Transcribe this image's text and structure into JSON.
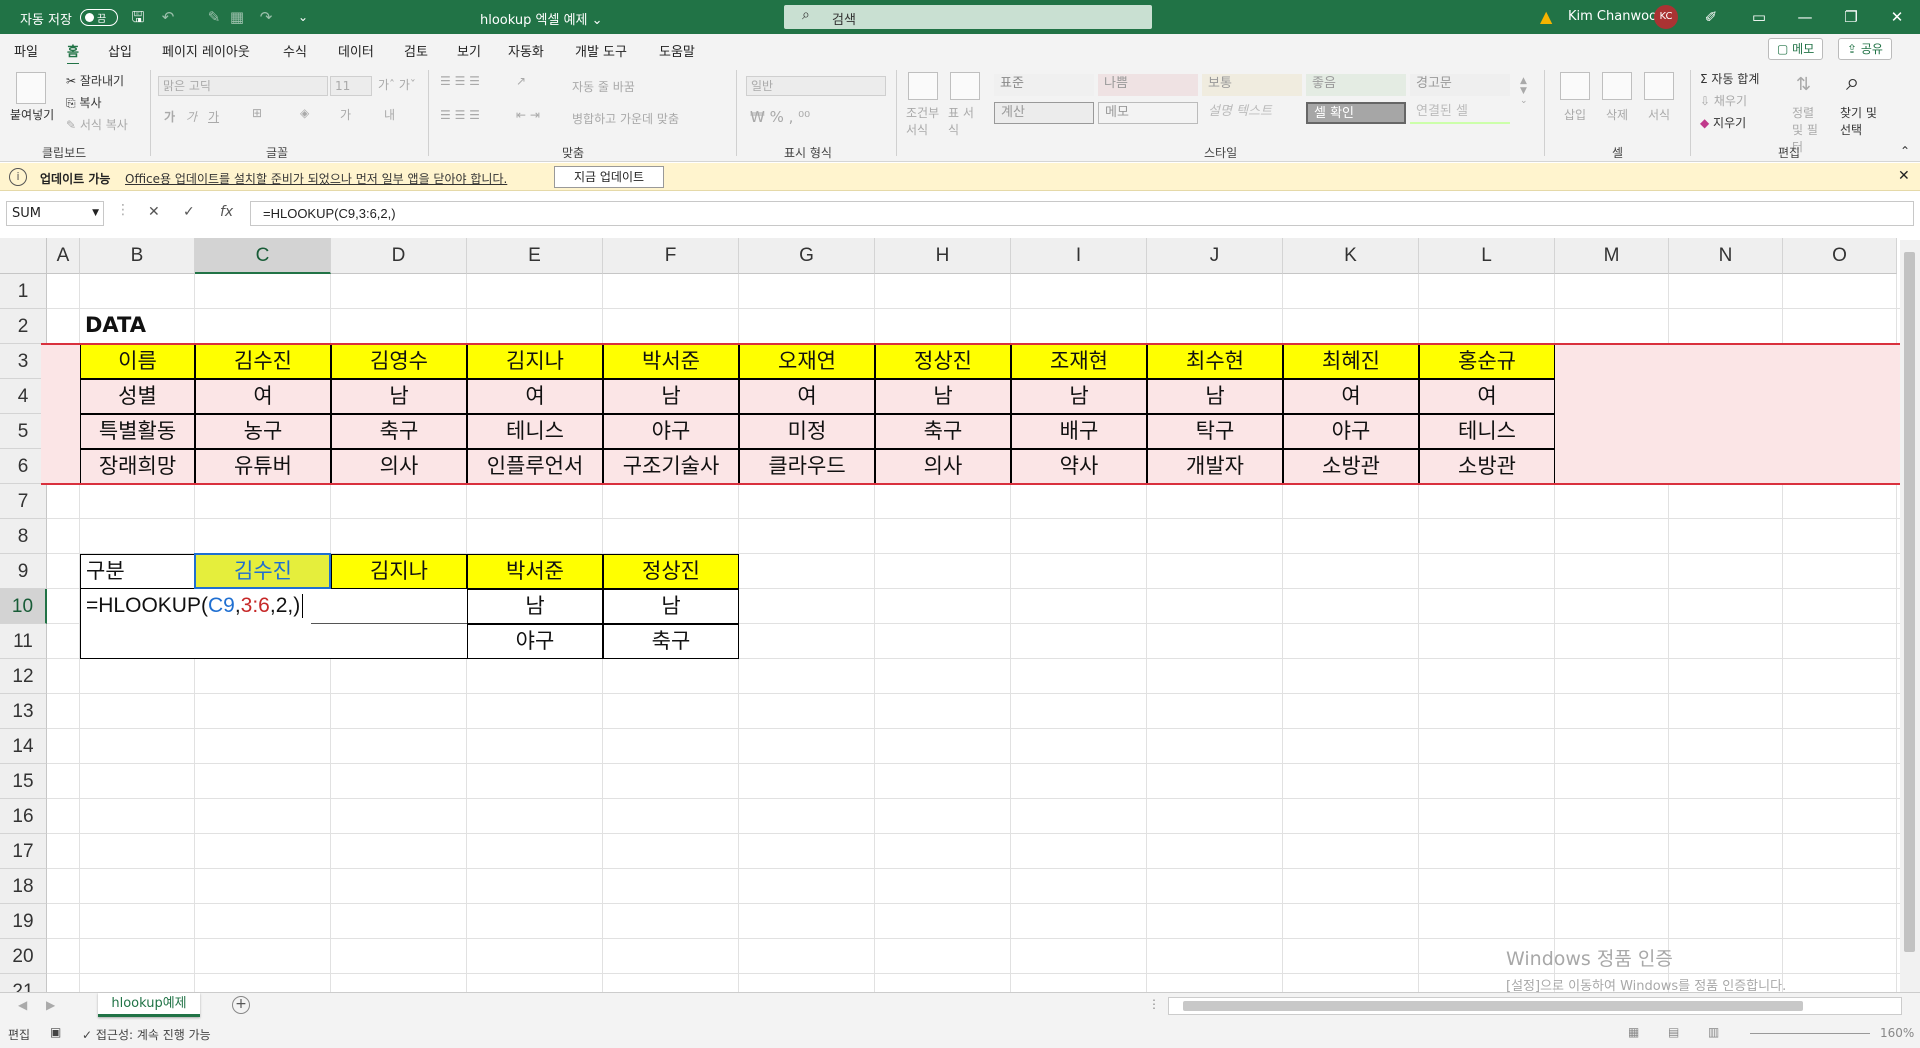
{
  "titlebar": {
    "autosave_label": "자동 저장",
    "autosave_state": "끔",
    "doc_title": "hlookup 엑셀 예제 ⌄",
    "search_placeholder": "검색",
    "user_name": "Kim Chanwoo",
    "user_initials": "KC"
  },
  "menu": {
    "tabs": [
      "파일",
      "홈",
      "삽입",
      "페이지 레이아웃",
      "수식",
      "데이터",
      "검토",
      "보기",
      "자동화",
      "개발 도구",
      "도움말"
    ],
    "active": "홈",
    "memo_label": "메모",
    "share_label": "공유"
  },
  "ribbon": {
    "clipboard": {
      "paste": "붙여넣기",
      "cut": "잘라내기",
      "copy": "복사",
      "format_painter": "서식 복사",
      "label": "클립보드"
    },
    "font": {
      "name": "맑은 고딕",
      "size": "11",
      "label": "글꼴"
    },
    "align": {
      "wrap": "자동 줄 바꿈",
      "merge": "병합하고 가운데 맞춤",
      "label": "맞춤"
    },
    "number": {
      "format": "일반",
      "label": "표시 형식"
    },
    "styles": {
      "cond_format": "조건부 서식",
      "table_format": "표 서식",
      "cells": [
        "표준",
        "나쁨",
        "보통",
        "좋음",
        "경고문",
        "계산",
        "메모",
        "설명 텍스트",
        "셀 확인",
        "연결된 셀"
      ],
      "label": "스타일"
    },
    "cells": {
      "insert": "삽입",
      "delete": "삭제",
      "format": "서식",
      "label": "셀"
    },
    "editing": {
      "autosum": "자동 합계",
      "fill": "채우기",
      "clear": "지우기",
      "sort": "정렬 및 필터",
      "find": "찾기 및 선택",
      "label": "편집"
    }
  },
  "infobar": {
    "title": "업데이트 가능",
    "message": "Office용 업데이트를 설치할 준비가 되었으나 먼저 일부 앱을 닫아야 합니다.",
    "button": "지금 업데이트"
  },
  "formulabar": {
    "namebox": "SUM",
    "formula": "=HLOOKUP(C9,3:6,2,)"
  },
  "grid": {
    "columns": [
      "A",
      "B",
      "C",
      "D",
      "E",
      "F",
      "G",
      "H",
      "I",
      "J",
      "K",
      "L",
      "M",
      "N",
      "O"
    ],
    "rows": [
      "1",
      "2",
      "3",
      "4",
      "5",
      "6",
      "7",
      "8",
      "9",
      "10",
      "11",
      "12",
      "13",
      "14",
      "15",
      "16",
      "17",
      "18",
      "19",
      "20",
      "21"
    ],
    "data_title": "DATA",
    "table": [
      [
        "이름",
        "김수진",
        "김영수",
        "김지나",
        "박서준",
        "오재연",
        "정상진",
        "조재현",
        "최수현",
        "최혜진",
        "홍순규"
      ],
      [
        "성별",
        "여",
        "남",
        "여",
        "남",
        "여",
        "남",
        "남",
        "남",
        "여",
        "여"
      ],
      [
        "특별활동",
        "농구",
        "축구",
        "테니스",
        "야구",
        "미정",
        "축구",
        "배구",
        "탁구",
        "야구",
        "테니스"
      ],
      [
        "장래희망",
        "유튜버",
        "의사",
        "인플루언서",
        "구조기술사",
        "클라우드",
        "의사",
        "약사",
        "개발자",
        "소방관",
        "소방관"
      ]
    ],
    "lookup_header": [
      "구분",
      "김수진",
      "김지나",
      "박서준",
      "정상진"
    ],
    "editing_formula": {
      "prefix": "=HLOOKUP(",
      "ref1": "C9",
      "comma1": ",",
      "ref2": "3:6",
      "suffix": ",2,)"
    },
    "row10_values": [
      "남",
      "남"
    ],
    "row11_values": [
      "야구",
      "축구"
    ],
    "ref_colors": {
      "ref1": "#1f6fd1",
      "ref2": "#c62828"
    }
  },
  "sheets": {
    "tabs": [
      "hlookup예제"
    ]
  },
  "statusbar": {
    "mode": "편집",
    "accessibility": "접근성: 계속 진행 가능",
    "zoom": "160%"
  },
  "watermark": {
    "line1": "Windows 정품 인증",
    "line2": "[설정]으로 이동하여 Windows를 정품 인증합니다."
  }
}
